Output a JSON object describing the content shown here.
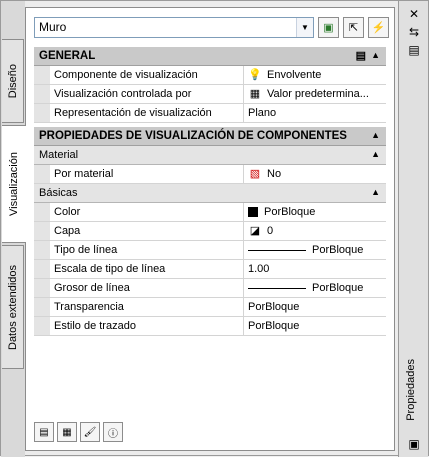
{
  "tabs": [
    {
      "label": "Diseño"
    },
    {
      "label": "Visualización"
    },
    {
      "label": "Datos extendidos"
    }
  ],
  "selector": {
    "value": "Muro"
  },
  "general": {
    "title": "GENERAL",
    "rows": [
      {
        "name": "Componente de visualización",
        "value": "Envolvente",
        "icon": "lightbulb-icon"
      },
      {
        "name": "Visualización controlada por",
        "value": "Valor predetermina...",
        "icon": "display-control-icon"
      },
      {
        "name": "Representación de visualización",
        "value": "Plano",
        "icon": ""
      }
    ]
  },
  "components": {
    "title": "PROPIEDADES DE VISUALIZACIÓN DE COMPONENTES",
    "material": {
      "title": "Material",
      "rows": [
        {
          "name": "Por material",
          "value": "No",
          "icon": "material-off-icon"
        }
      ]
    },
    "basic": {
      "title": "Básicas",
      "rows": [
        {
          "name": "Color",
          "value": "PorBloque",
          "kind": "swatch"
        },
        {
          "name": "Capa",
          "value": "0",
          "kind": "layer"
        },
        {
          "name": "Tipo de línea",
          "value": "PorBloque",
          "kind": "line"
        },
        {
          "name": "Escala de tipo de línea",
          "value": "1.00",
          "kind": "text"
        },
        {
          "name": "Grosor de línea",
          "value": "PorBloque",
          "kind": "line"
        },
        {
          "name": "Transparencia",
          "value": "PorBloque",
          "kind": "text"
        },
        {
          "name": "Estilo de trazado",
          "value": "PorBloque",
          "kind": "text"
        }
      ]
    }
  },
  "palette_title": "Propiedades"
}
